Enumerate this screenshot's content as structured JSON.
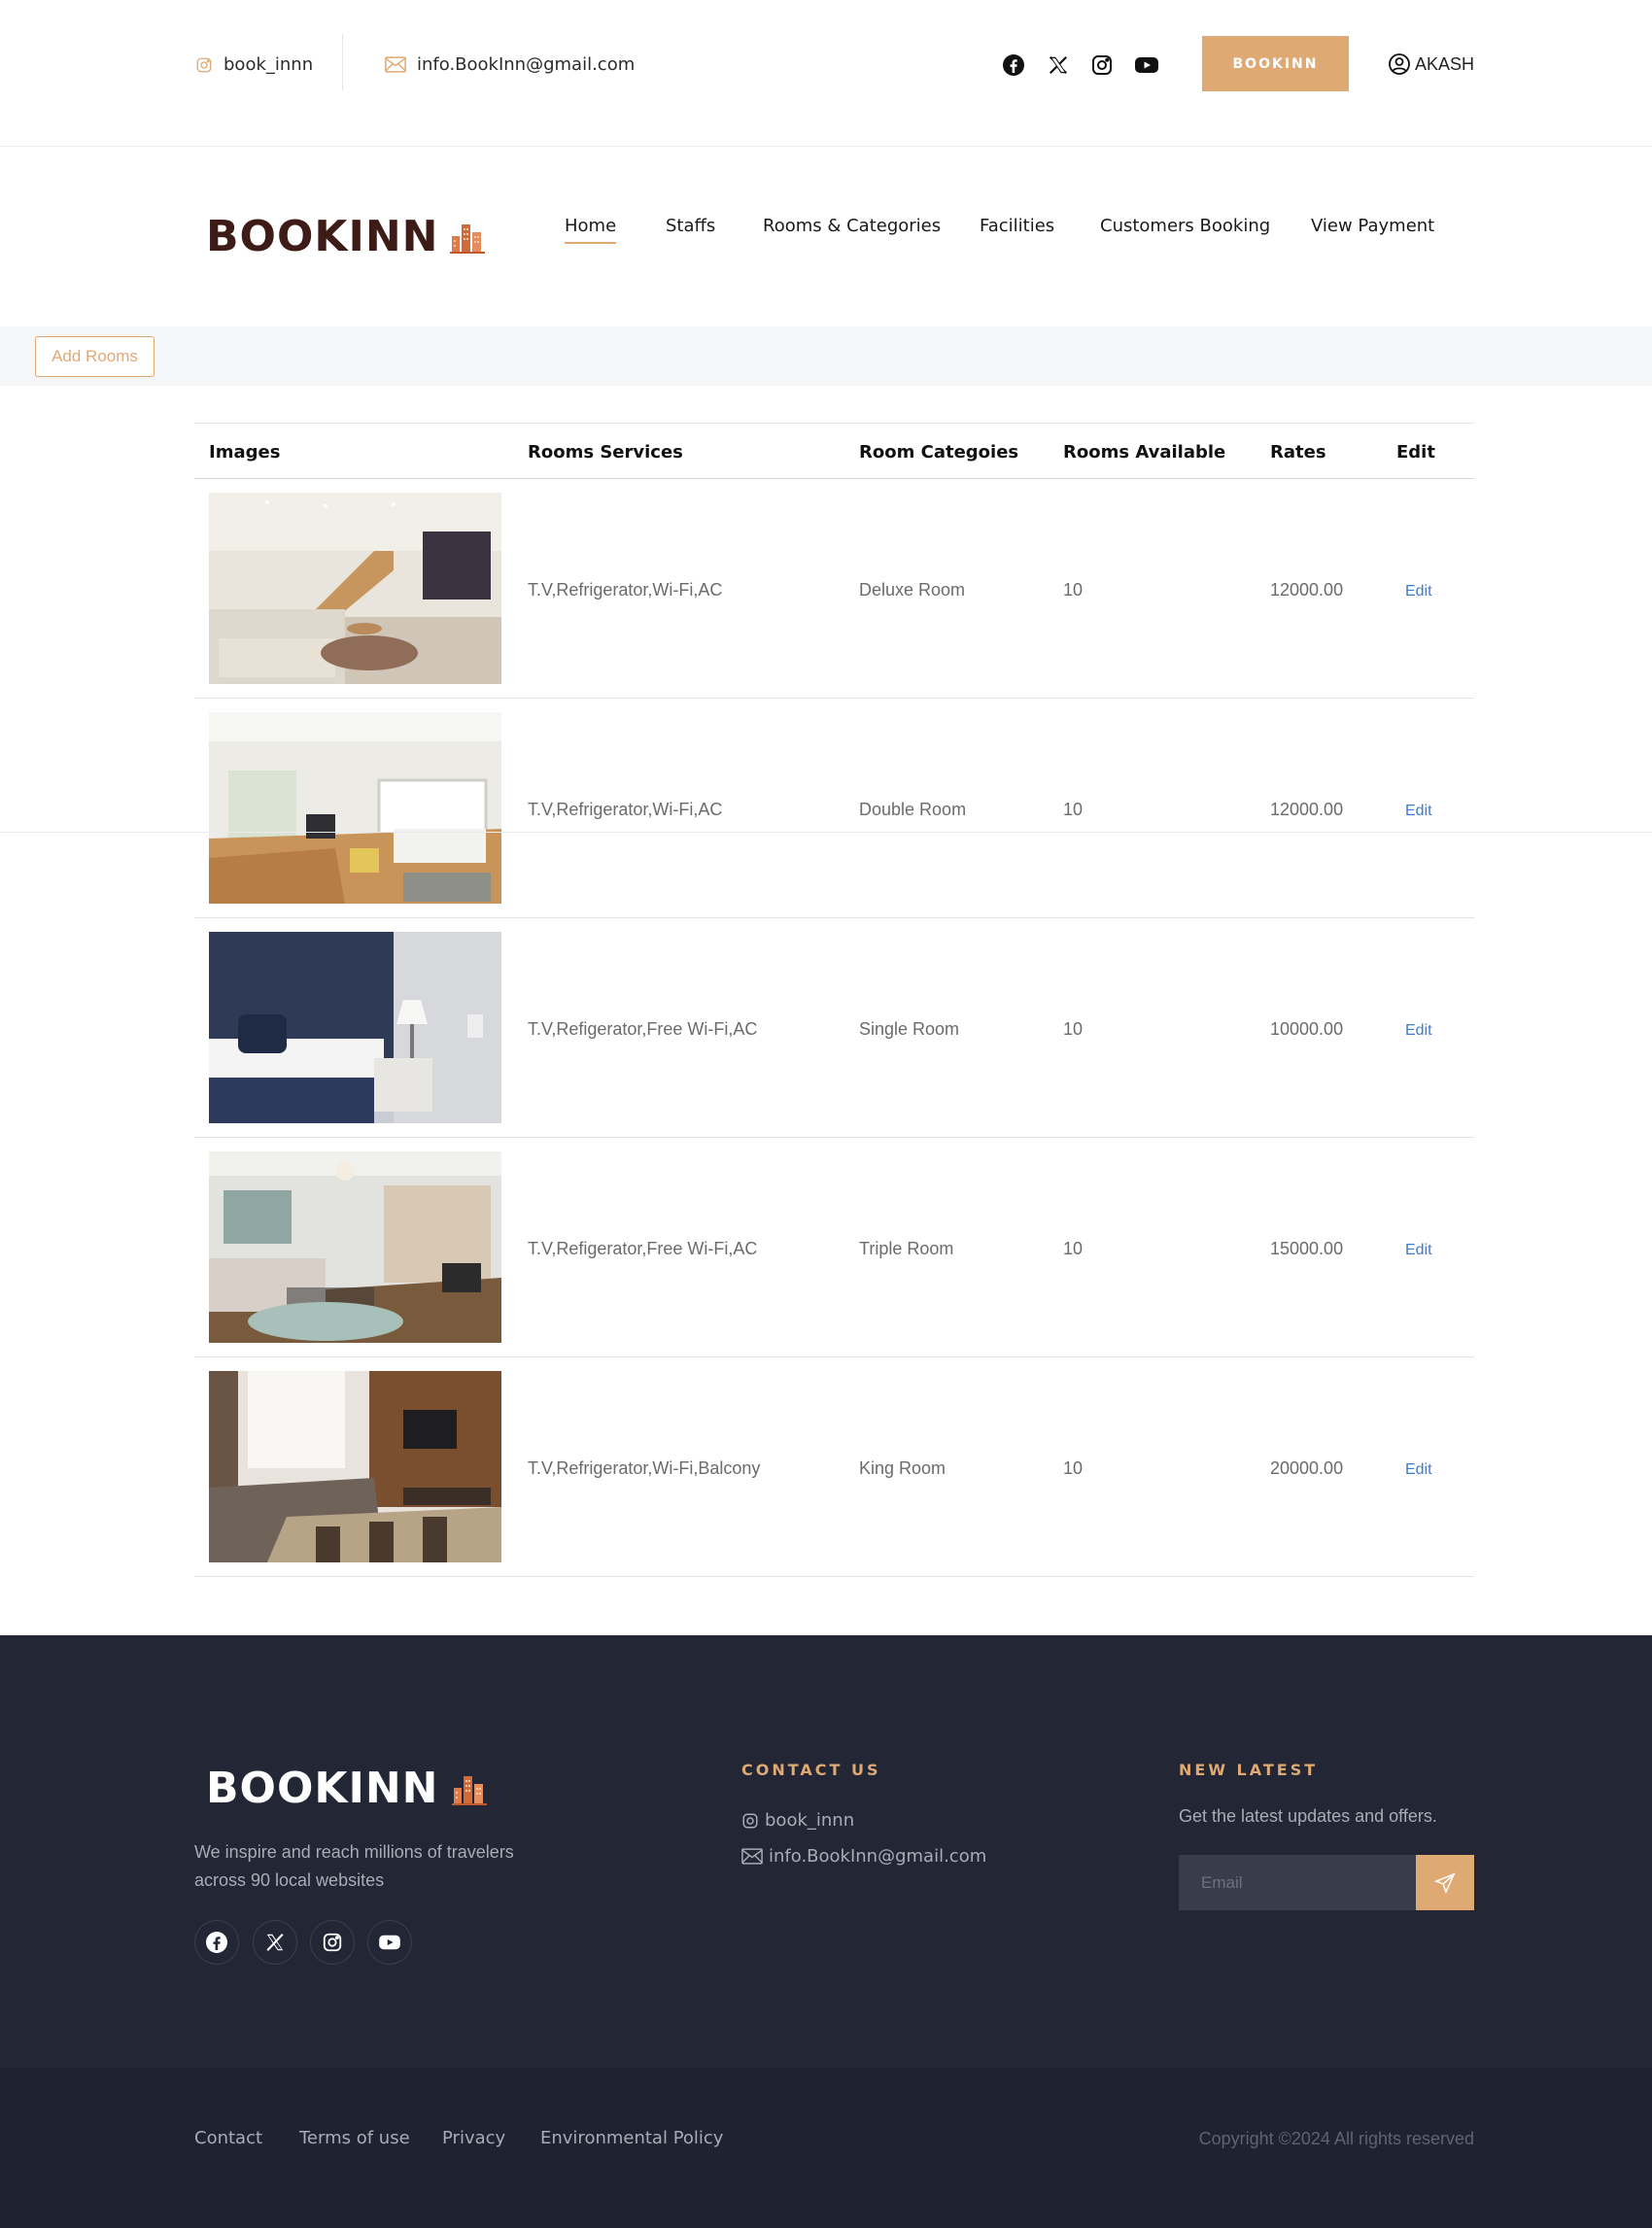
{
  "topbar": {
    "instagram_handle": "book_innn",
    "email": "info.BookInn@gmail.com",
    "book_button": "BOOKINN",
    "user_name": "AKASH",
    "social_icons": [
      "facebook-icon",
      "x-icon",
      "instagram-icon",
      "youtube-icon"
    ]
  },
  "brand": {
    "logo_text": "BOOKINN"
  },
  "nav": {
    "items": [
      {
        "label": "Home",
        "active": true
      },
      {
        "label": "Staffs"
      },
      {
        "label": "Rooms & Categories"
      },
      {
        "label": "Facilities"
      },
      {
        "label": "Customers Booking"
      },
      {
        "label": "View Payment"
      }
    ]
  },
  "actions": {
    "add_rooms": "Add Rooms"
  },
  "table": {
    "headers": [
      "Images",
      "Rooms Services",
      "Room Categoies",
      "Rooms Available",
      "Rates",
      "Edit"
    ],
    "rows": [
      {
        "services": "T.V,Refrigerator,Wi-Fi,AC",
        "category": "Deluxe Room",
        "available": "10",
        "rate": "12000.00",
        "edit": "Edit"
      },
      {
        "services": "T.V,Refrigerator,Wi-Fi,AC",
        "category": "Double Room",
        "available": "10",
        "rate": "12000.00",
        "edit": "Edit"
      },
      {
        "services": "T.V,Refigerator,Free Wi-Fi,AC",
        "category": "Single Room",
        "available": "10",
        "rate": "10000.00",
        "edit": "Edit"
      },
      {
        "services": "T.V,Refigerator,Free Wi-Fi,AC",
        "category": "Triple Room",
        "available": "10",
        "rate": "15000.00",
        "edit": "Edit"
      },
      {
        "services": "T.V,Refrigerator,Wi-Fi,Balcony",
        "category": "King Room",
        "available": "10",
        "rate": "20000.00",
        "edit": "Edit"
      }
    ]
  },
  "footer": {
    "logo_text": "BOOKINN",
    "description": "We inspire and reach millions of travelers across 90 local websites",
    "contact_heading": "CONTACT US",
    "contact_instagram": "book_innn",
    "contact_email": "info.BookInn@gmail.com",
    "latest_heading": "NEW LATEST",
    "latest_text": "Get the latest updates and offers.",
    "email_placeholder": "Email",
    "links": [
      "Contact",
      "Terms of use",
      "Privacy",
      "Environmental Policy"
    ],
    "copyright": "Copyright ©2024 All rights reserved"
  },
  "colors": {
    "accent": "#dfa974",
    "footer_bg": "#232634",
    "bottom_bg": "#1f2230",
    "logo_dark": "#3d1b16",
    "link_blue": "#3d7bd1"
  }
}
